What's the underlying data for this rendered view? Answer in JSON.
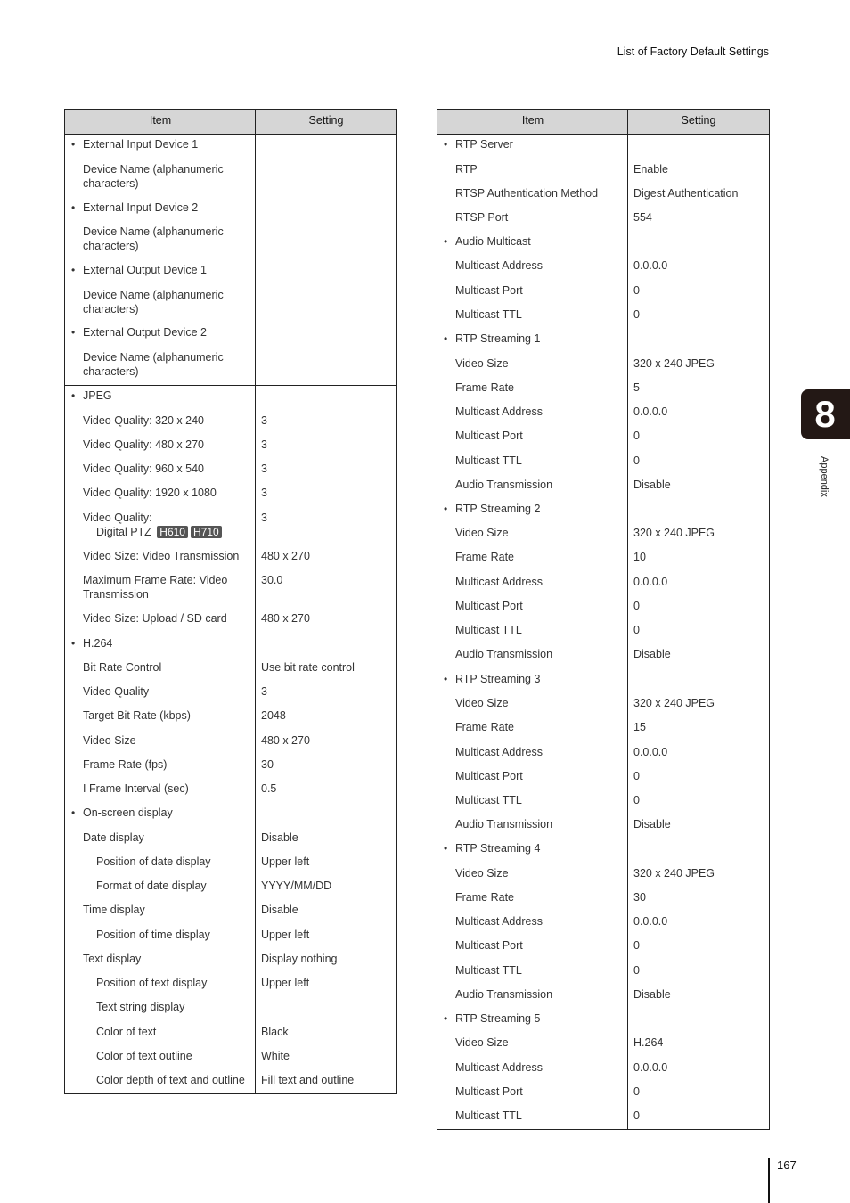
{
  "header": {
    "running_title": "List of Factory Default Settings"
  },
  "chapter": {
    "number": "8",
    "label": "Appendix",
    "accent_color": "#231815"
  },
  "footer": {
    "page_number": "167"
  },
  "left_table": {
    "columns": [
      "Item",
      "Setting"
    ],
    "rows": [
      {
        "item": "External Input Device 1",
        "setting": "",
        "bullet": true,
        "indent": 0
      },
      {
        "item": "Device Name (alphanumeric\ncharacters)",
        "setting": "",
        "bullet": false,
        "indent": 0
      },
      {
        "item": "External Input Device 2",
        "setting": "",
        "bullet": true,
        "indent": 0
      },
      {
        "item": "Device Name (alphanumeric\ncharacters)",
        "setting": "",
        "bullet": false,
        "indent": 0
      },
      {
        "item": "External Output Device 1",
        "setting": "",
        "bullet": true,
        "indent": 0
      },
      {
        "item": "Device Name (alphanumeric\ncharacters)",
        "setting": "",
        "bullet": false,
        "indent": 0
      },
      {
        "item": "External Output Device 2",
        "setting": "",
        "bullet": true,
        "indent": 0
      },
      {
        "item": "Device Name (alphanumeric\ncharacters)",
        "setting": "",
        "bullet": false,
        "indent": 0
      },
      {
        "item": "JPEG",
        "setting": "",
        "bullet": true,
        "indent": 0,
        "section_break": true
      },
      {
        "item": "Video Quality: 320 x 240",
        "setting": "3",
        "bullet": false,
        "indent": 0
      },
      {
        "item": "Video Quality: 480 x 270",
        "setting": "3",
        "bullet": false,
        "indent": 0
      },
      {
        "item": "Video Quality: 960 x 540",
        "setting": "3",
        "bullet": false,
        "indent": 0
      },
      {
        "item": "Video Quality: 1920 x 1080",
        "setting": "3",
        "bullet": false,
        "indent": 0
      },
      {
        "item": "Video Quality:",
        "item_line2": "Digital PTZ",
        "badges": [
          "H610",
          "H710"
        ],
        "setting": "3",
        "bullet": false,
        "indent": 0
      },
      {
        "item": "Video Size: Video Transmission",
        "setting": "480 x 270",
        "bullet": false,
        "indent": 0
      },
      {
        "item": "Maximum Frame Rate: Video\nTransmission",
        "setting": "30.0",
        "bullet": false,
        "indent": 0
      },
      {
        "item": "Video Size: Upload / SD card",
        "setting": "480 x 270",
        "bullet": false,
        "indent": 0
      },
      {
        "item": "H.264",
        "setting": "",
        "bullet": true,
        "indent": 0
      },
      {
        "item": "Bit Rate Control",
        "setting": "Use bit rate control",
        "bullet": false,
        "indent": 0
      },
      {
        "item": "Video Quality",
        "setting": "3",
        "bullet": false,
        "indent": 0
      },
      {
        "item": "Target Bit Rate (kbps)",
        "setting": "2048",
        "bullet": false,
        "indent": 0
      },
      {
        "item": "Video Size",
        "setting": "480 x 270",
        "bullet": false,
        "indent": 0
      },
      {
        "item": "Frame Rate (fps)",
        "setting": "30",
        "bullet": false,
        "indent": 0
      },
      {
        "item": "I Frame Interval (sec)",
        "setting": "0.5",
        "bullet": false,
        "indent": 0
      },
      {
        "item": "On-screen display",
        "setting": "",
        "bullet": true,
        "indent": 0
      },
      {
        "item": "Date display",
        "setting": "Disable",
        "bullet": false,
        "indent": 0
      },
      {
        "item": "Position of date display",
        "setting": "Upper left",
        "bullet": false,
        "indent": 1
      },
      {
        "item": "Format of date display",
        "setting": "YYYY/MM/DD",
        "bullet": false,
        "indent": 1
      },
      {
        "item": "Time display",
        "setting": "Disable",
        "bullet": false,
        "indent": 0
      },
      {
        "item": "Position of time display",
        "setting": "Upper left",
        "bullet": false,
        "indent": 1
      },
      {
        "item": "Text display",
        "setting": "Display nothing",
        "bullet": false,
        "indent": 0
      },
      {
        "item": "Position of text display",
        "setting": "Upper left",
        "bullet": false,
        "indent": 1
      },
      {
        "item": "Text string display",
        "setting": "",
        "bullet": false,
        "indent": 1
      },
      {
        "item": "Color of text",
        "setting": "Black",
        "bullet": false,
        "indent": 1
      },
      {
        "item": "Color of text outline",
        "setting": "White",
        "bullet": false,
        "indent": 1
      },
      {
        "item": "Color depth of text and outline",
        "setting": "Fill text and outline",
        "bullet": false,
        "indent": 1
      }
    ]
  },
  "right_table": {
    "columns": [
      "Item",
      "Setting"
    ],
    "rows": [
      {
        "item": "RTP Server",
        "setting": "",
        "bullet": true
      },
      {
        "item": "RTP",
        "setting": "Enable",
        "bullet": false
      },
      {
        "item": "RTSP Authentication Method",
        "setting": "Digest Authentication",
        "bullet": false
      },
      {
        "item": "RTSP Port",
        "setting": "554",
        "bullet": false
      },
      {
        "item": "Audio Multicast",
        "setting": "",
        "bullet": true
      },
      {
        "item": "Multicast Address",
        "setting": "0.0.0.0",
        "bullet": false
      },
      {
        "item": "Multicast Port",
        "setting": "0",
        "bullet": false
      },
      {
        "item": "Multicast TTL",
        "setting": "0",
        "bullet": false
      },
      {
        "item": "RTP Streaming 1",
        "setting": "",
        "bullet": true
      },
      {
        "item": "Video Size",
        "setting": "320 x 240 JPEG",
        "bullet": false
      },
      {
        "item": "Frame Rate",
        "setting": "5",
        "bullet": false
      },
      {
        "item": "Multicast Address",
        "setting": "0.0.0.0",
        "bullet": false
      },
      {
        "item": "Multicast Port",
        "setting": "0",
        "bullet": false
      },
      {
        "item": "Multicast TTL",
        "setting": "0",
        "bullet": false
      },
      {
        "item": "Audio Transmission",
        "setting": "Disable",
        "bullet": false
      },
      {
        "item": "RTP Streaming 2",
        "setting": "",
        "bullet": true
      },
      {
        "item": "Video Size",
        "setting": "320 x 240 JPEG",
        "bullet": false
      },
      {
        "item": "Frame Rate",
        "setting": "10",
        "bullet": false
      },
      {
        "item": "Multicast Address",
        "setting": "0.0.0.0",
        "bullet": false
      },
      {
        "item": "Multicast Port",
        "setting": "0",
        "bullet": false
      },
      {
        "item": "Multicast TTL",
        "setting": "0",
        "bullet": false
      },
      {
        "item": "Audio Transmission",
        "setting": "Disable",
        "bullet": false
      },
      {
        "item": "RTP Streaming 3",
        "setting": "",
        "bullet": true
      },
      {
        "item": "Video Size",
        "setting": "320 x 240 JPEG",
        "bullet": false
      },
      {
        "item": "Frame Rate",
        "setting": "15",
        "bullet": false
      },
      {
        "item": "Multicast Address",
        "setting": "0.0.0.0",
        "bullet": false
      },
      {
        "item": "Multicast Port",
        "setting": "0",
        "bullet": false
      },
      {
        "item": "Multicast TTL",
        "setting": "0",
        "bullet": false
      },
      {
        "item": "Audio Transmission",
        "setting": "Disable",
        "bullet": false
      },
      {
        "item": "RTP Streaming 4",
        "setting": "",
        "bullet": true
      },
      {
        "item": "Video Size",
        "setting": "320 x 240 JPEG",
        "bullet": false
      },
      {
        "item": "Frame Rate",
        "setting": "30",
        "bullet": false
      },
      {
        "item": "Multicast Address",
        "setting": "0.0.0.0",
        "bullet": false
      },
      {
        "item": "Multicast Port",
        "setting": "0",
        "bullet": false
      },
      {
        "item": "Multicast TTL",
        "setting": "0",
        "bullet": false
      },
      {
        "item": "Audio Transmission",
        "setting": "Disable",
        "bullet": false
      },
      {
        "item": "RTP Streaming 5",
        "setting": "",
        "bullet": true
      },
      {
        "item": "Video Size",
        "setting": "H.264",
        "bullet": false
      },
      {
        "item": "Multicast Address",
        "setting": "0.0.0.0",
        "bullet": false
      },
      {
        "item": "Multicast Port",
        "setting": "0",
        "bullet": false
      },
      {
        "item": "Multicast TTL",
        "setting": "0",
        "bullet": false
      }
    ]
  }
}
